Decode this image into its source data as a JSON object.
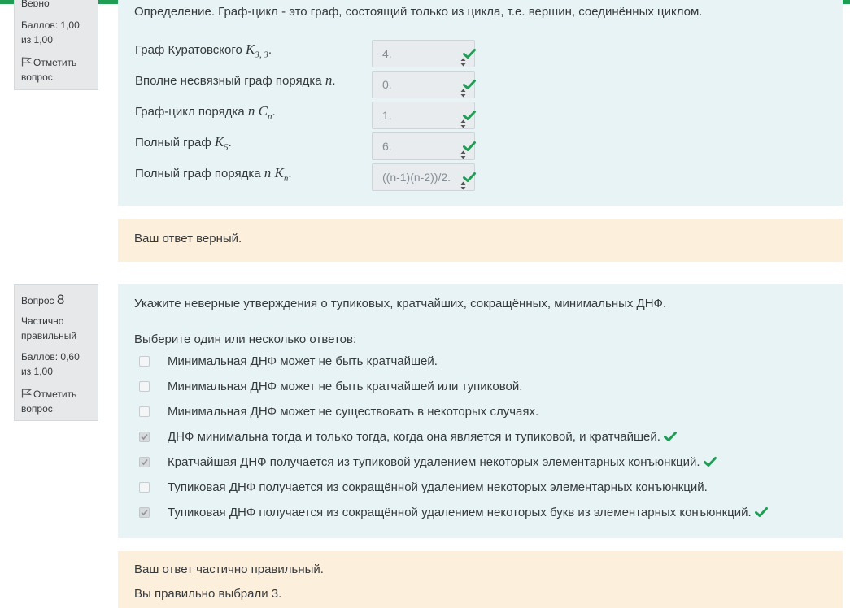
{
  "q7": {
    "info": {
      "state": "Верно",
      "grade": "Баллов: 1,00 из 1,00",
      "flag_label": "Отметить вопрос"
    },
    "definition": "Определение. Граф-цикл - это граф, состоящий только из цикла, т.е. вершин, соединённых циклом.",
    "rows": [
      {
        "text": "Граф Куратовского ",
        "math": "K",
        "sub": "3, 3",
        "after": ".",
        "answer": "4.",
        "correct": true
      },
      {
        "text": "Вполне несвязный граф порядка ",
        "math": "n",
        "sub": "",
        "after": ".",
        "answer": "0.",
        "correct": true
      },
      {
        "text": "Граф-цикл порядка ",
        "math": "n C",
        "sub": "n",
        "after": ".",
        "answer": "1.",
        "correct": true
      },
      {
        "text": "Полный граф ",
        "math": "K",
        "sub": "5",
        "after": ".",
        "answer": "6.",
        "correct": true
      },
      {
        "text": "Полный граф порядка ",
        "math": "n K",
        "sub": "n",
        "after": ".",
        "answer": "((n-1)(n-2))/2.",
        "correct": true
      }
    ],
    "feedback": "Ваш ответ верный."
  },
  "q8": {
    "info": {
      "label": "Вопрос",
      "number": "8",
      "state": "Частично правильный",
      "grade": "Баллов: 0,60 из 1,00",
      "flag_label": "Отметить вопрос"
    },
    "question": "Укажите неверные утверждения о тупиковых, кратчайших, сокращённых, минимальных ДНФ.",
    "prompt": "Выберите один или несколько ответов:",
    "options": [
      {
        "text": "Минимальная ДНФ может не быть кратчайшей.",
        "checked": false,
        "correct": false
      },
      {
        "text": "Минимальная ДНФ может не быть кратчайшей или тупиковой.",
        "checked": false,
        "correct": false
      },
      {
        "text": "Минимальная ДНФ может не существовать в некоторых случаях.",
        "checked": false,
        "correct": false
      },
      {
        "text": "ДНФ минимальна тогда и только тогда, когда она является и тупиковой, и кратчайшей.",
        "checked": true,
        "correct": true
      },
      {
        "text": "Кратчайшая ДНФ получается из тупиковой удалением некоторых элементарных конъюнкций.",
        "checked": true,
        "correct": true
      },
      {
        "text": "Тупиковая ДНФ получается из сокращённой удалением некоторых элементарных конъюнкций.",
        "checked": false,
        "correct": false
      },
      {
        "text": "Тупиковая ДНФ получается из сокращённой удалением некоторых букв из элементарных конъюнкций.",
        "checked": true,
        "correct": true
      }
    ],
    "feedback": "Ваш ответ частично правильный.",
    "feedback2": "Вы правильно выбрали 3."
  },
  "colors": {
    "correct": "#1f9d55",
    "formulation_bg": "#e7f3f5",
    "feedback_bg": "#fcefdc",
    "info_bg": "#e6e8ea"
  }
}
